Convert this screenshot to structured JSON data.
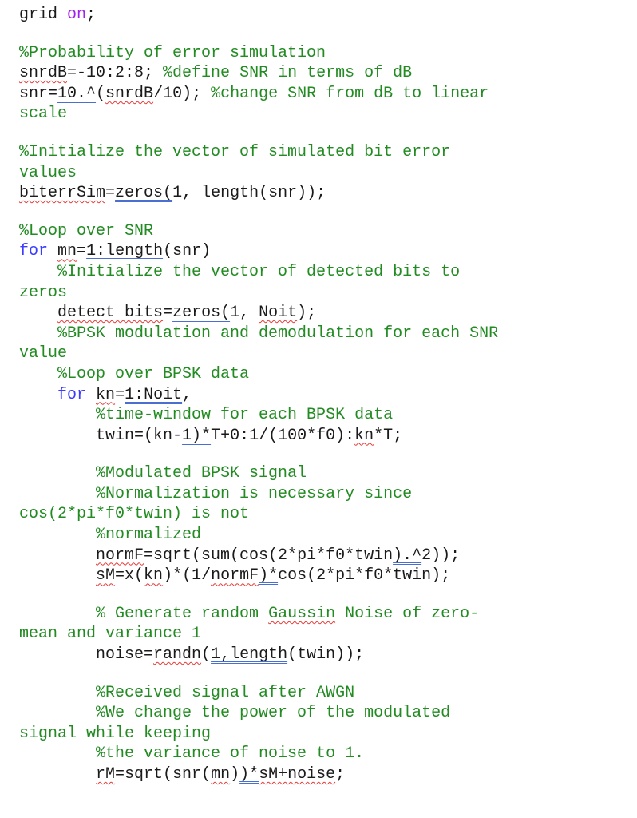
{
  "document": {
    "lines": [
      {
        "segments": [
          {
            "t": "grid ",
            "c": "code"
          },
          {
            "t": "on",
            "c": "kwp"
          },
          {
            "t": ";",
            "c": "code"
          }
        ]
      },
      {
        "blank": true
      },
      {
        "segments": [
          {
            "t": "%Probability of error simulation",
            "c": "cm"
          }
        ]
      },
      {
        "segments": [
          {
            "t": "snrdB",
            "c": "code",
            "m": "sp"
          },
          {
            "t": "=-10:2:8; ",
            "c": "code"
          },
          {
            "t": "%define SNR in terms of dB",
            "c": "cm"
          }
        ]
      },
      {
        "segments": [
          {
            "t": "snr=",
            "c": "code"
          },
          {
            "t": "10.^",
            "c": "code",
            "m": "gr"
          },
          {
            "t": "(",
            "c": "code"
          },
          {
            "t": "snrdB",
            "c": "code",
            "m": "sp"
          },
          {
            "t": "/10); ",
            "c": "code"
          },
          {
            "t": "%change SNR from dB to linear",
            "c": "cm"
          }
        ]
      },
      {
        "segments": [
          {
            "t": "scale",
            "c": "cm"
          }
        ]
      },
      {
        "blank": true
      },
      {
        "segments": [
          {
            "t": "%Initialize the vector of simulated bit error",
            "c": "cm"
          }
        ]
      },
      {
        "segments": [
          {
            "t": "values",
            "c": "cm"
          }
        ]
      },
      {
        "segments": [
          {
            "t": "biterrSim",
            "c": "code",
            "m": "sp"
          },
          {
            "t": "=",
            "c": "code"
          },
          {
            "t": "zeros(",
            "c": "code",
            "m": "gr"
          },
          {
            "t": "1, length(snr));",
            "c": "code"
          }
        ]
      },
      {
        "blank": true
      },
      {
        "segments": [
          {
            "t": "%Loop over SNR",
            "c": "cm"
          }
        ]
      },
      {
        "segments": [
          {
            "t": "for",
            "c": "kw"
          },
          {
            "t": " ",
            "c": "code"
          },
          {
            "t": "mn",
            "c": "code",
            "m": "sp"
          },
          {
            "t": "=",
            "c": "code"
          },
          {
            "t": "1:length",
            "c": "code",
            "m": "gr"
          },
          {
            "t": "(snr)",
            "c": "code"
          }
        ]
      },
      {
        "segments": [
          {
            "t": "    %Initialize the vector of detected bits to",
            "c": "cm"
          }
        ]
      },
      {
        "segments": [
          {
            "t": "zeros",
            "c": "cm"
          }
        ]
      },
      {
        "segments": [
          {
            "t": "    ",
            "c": "code"
          },
          {
            "t": "detect bits",
            "c": "code",
            "m": "sp"
          },
          {
            "t": "=",
            "c": "code"
          },
          {
            "t": "zeros(",
            "c": "code",
            "m": "gr"
          },
          {
            "t": "1, ",
            "c": "code"
          },
          {
            "t": "Noit",
            "c": "code",
            "m": "sp"
          },
          {
            "t": ");",
            "c": "code"
          }
        ]
      },
      {
        "segments": [
          {
            "t": "    %BPSK modulation and demodulation for each SNR",
            "c": "cm"
          }
        ]
      },
      {
        "segments": [
          {
            "t": "value",
            "c": "cm"
          }
        ]
      },
      {
        "segments": [
          {
            "t": "    %Loop over BPSK data",
            "c": "cm"
          }
        ]
      },
      {
        "segments": [
          {
            "t": "    ",
            "c": "code"
          },
          {
            "t": "for",
            "c": "kw"
          },
          {
            "t": " ",
            "c": "code"
          },
          {
            "t": "kn",
            "c": "code",
            "m": "sp"
          },
          {
            "t": "=",
            "c": "code"
          },
          {
            "t": "1:Noit",
            "c": "code",
            "m": "gr"
          },
          {
            "t": ",",
            "c": "code"
          }
        ]
      },
      {
        "segments": [
          {
            "t": "        %time-window for each BPSK data",
            "c": "cm"
          }
        ]
      },
      {
        "segments": [
          {
            "t": "        twin=(kn-",
            "c": "code"
          },
          {
            "t": "1)*",
            "c": "code",
            "m": "gr"
          },
          {
            "t": "T+0:1/(100*f0):",
            "c": "code"
          },
          {
            "t": "kn",
            "c": "code",
            "m": "sp"
          },
          {
            "t": "*T;",
            "c": "code"
          }
        ]
      },
      {
        "blank": true
      },
      {
        "segments": [
          {
            "t": "        %Modulated BPSK signal",
            "c": "cm"
          }
        ]
      },
      {
        "segments": [
          {
            "t": "        %Normalization is necessary since",
            "c": "cm"
          }
        ]
      },
      {
        "segments": [
          {
            "t": "cos(2*pi*f0*twin) is not",
            "c": "cm"
          }
        ]
      },
      {
        "segments": [
          {
            "t": "        %normalized",
            "c": "cm"
          }
        ]
      },
      {
        "segments": [
          {
            "t": "        ",
            "c": "code"
          },
          {
            "t": "normF",
            "c": "code",
            "m": "sp"
          },
          {
            "t": "=sqrt(sum(cos(2*pi*f0*twin",
            "c": "code"
          },
          {
            "t": ").^",
            "c": "code",
            "m": "gr"
          },
          {
            "t": "2));",
            "c": "code"
          }
        ]
      },
      {
        "segments": [
          {
            "t": "        ",
            "c": "code"
          },
          {
            "t": "sM",
            "c": "code",
            "m": "sp"
          },
          {
            "t": "=x(",
            "c": "code"
          },
          {
            "t": "kn",
            "c": "code",
            "m": "sp"
          },
          {
            "t": ")*(1/",
            "c": "code"
          },
          {
            "t": "normF",
            "c": "code",
            "m": "sp"
          },
          {
            "t": ")*",
            "c": "code",
            "m": "gr"
          },
          {
            "t": "cos(2*pi*f0*twin);",
            "c": "code"
          }
        ]
      },
      {
        "blank": true
      },
      {
        "segments": [
          {
            "t": "        % Generate random ",
            "c": "cm"
          },
          {
            "t": "Gaussin",
            "c": "cm",
            "m": "sp"
          },
          {
            "t": " Noise of zero-",
            "c": "cm"
          }
        ]
      },
      {
        "segments": [
          {
            "t": "mean and variance 1",
            "c": "cm"
          }
        ]
      },
      {
        "segments": [
          {
            "t": "        noise=",
            "c": "code"
          },
          {
            "t": "randn",
            "c": "code",
            "m": "sp"
          },
          {
            "t": "(",
            "c": "code"
          },
          {
            "t": "1,length",
            "c": "code",
            "m": "gr"
          },
          {
            "t": "(twin));",
            "c": "code"
          }
        ]
      },
      {
        "blank": true
      },
      {
        "segments": [
          {
            "t": "        %Received signal after AWGN",
            "c": "cm"
          }
        ]
      },
      {
        "segments": [
          {
            "t": "        %We change the power of the modulated",
            "c": "cm"
          }
        ]
      },
      {
        "segments": [
          {
            "t": "signal while keeping",
            "c": "cm"
          }
        ]
      },
      {
        "segments": [
          {
            "t": "        %the variance of noise to 1.",
            "c": "cm"
          }
        ]
      },
      {
        "segments": [
          {
            "t": "        ",
            "c": "code"
          },
          {
            "t": "rM",
            "c": "code",
            "m": "sp"
          },
          {
            "t": "=sqrt(snr(",
            "c": "code"
          },
          {
            "t": "mn",
            "c": "code",
            "m": "sp"
          },
          {
            "t": ")",
            "c": "code"
          },
          {
            "t": ")*",
            "c": "code",
            "m": "gr"
          },
          {
            "t": "sM+noise",
            "c": "code",
            "m": "sp"
          },
          {
            "t": ";",
            "c": "code"
          }
        ]
      }
    ]
  }
}
